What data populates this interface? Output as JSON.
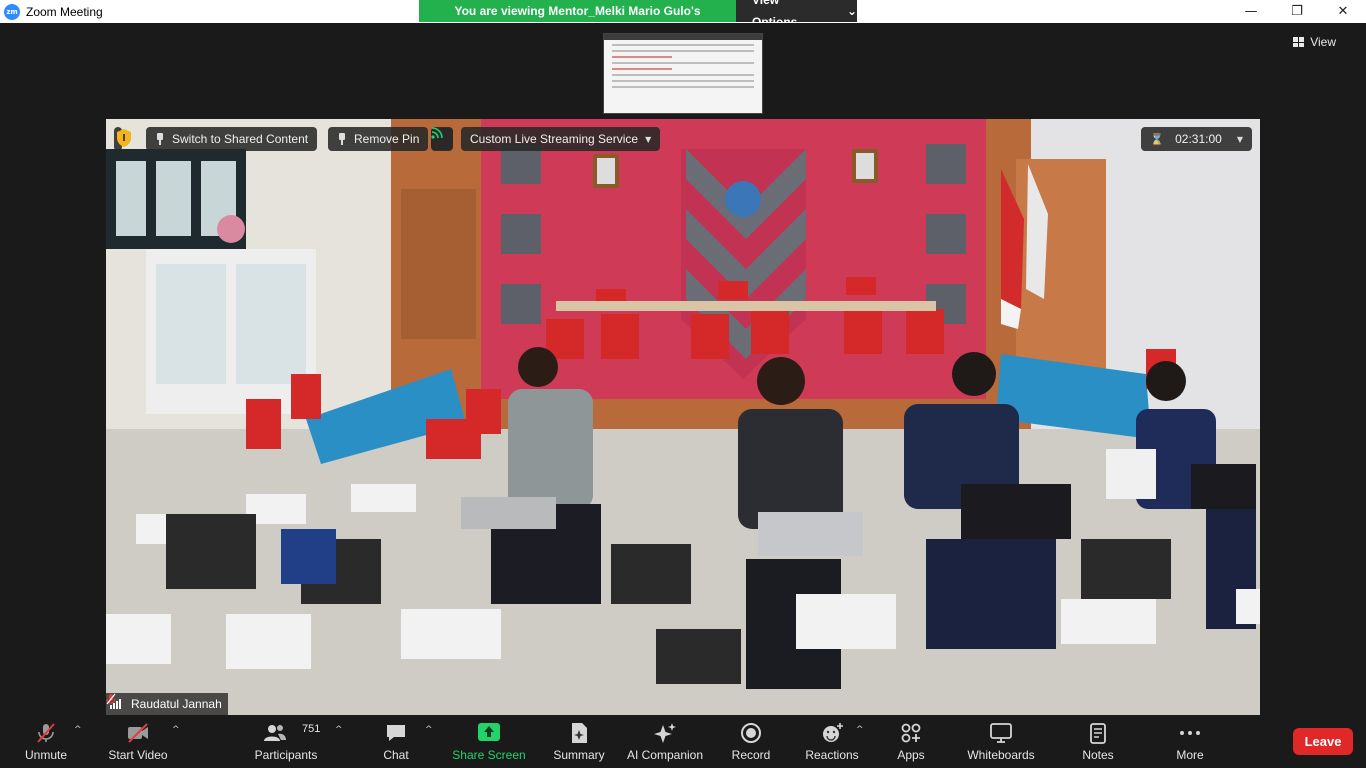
{
  "window": {
    "title": "Zoom Meeting",
    "logo_text": "zm",
    "minimize": "—",
    "maximize": "❐",
    "close": "✕"
  },
  "banner": {
    "viewing_text": "You are viewing Mentor_Melki Mario Gulo's screen",
    "options_label": "View Options",
    "options_caret": "⌄"
  },
  "stage": {
    "view_label": "View"
  },
  "video": {
    "switch_label": "Switch to Shared Content",
    "remove_pin_label": "Remove Pin",
    "streaming_label": "Custom Live Streaming Service",
    "streaming_caret": "▼",
    "timer_value": "02:31:00",
    "timer_caret": "▼",
    "participant_name": "Raudatul Jannah"
  },
  "toolbar": {
    "unmute": "Unmute",
    "start_video": "Start Video",
    "participants": "Participants",
    "participant_count": "751",
    "chat": "Chat",
    "share_screen": "Share Screen",
    "summary": "Summary",
    "ai_companion": "AI Companion",
    "record": "Record",
    "reactions": "Reactions",
    "apps": "Apps",
    "whiteboards": "Whiteboards",
    "notes": "Notes",
    "more": "More",
    "leave": "Leave",
    "caret": "^"
  },
  "colors": {
    "share_green": "#23b14d",
    "leave_red": "#e02828",
    "zoom_blue": "#2d8cff"
  }
}
